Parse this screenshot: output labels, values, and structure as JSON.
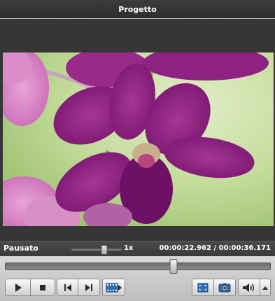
{
  "window": {
    "title": "Progetto"
  },
  "player": {
    "status": "Pausato",
    "speed_label": "1x",
    "speed_level": 0.65,
    "time_display": "00:00:22.962 / 00:00:36.171",
    "seek_progress": 0.635
  },
  "controls": {
    "buttons": [
      {
        "name": "play-button",
        "icon": "play-icon"
      },
      {
        "name": "stop-button",
        "icon": "stop-icon"
      },
      {
        "name": "previous-button",
        "icon": "skip-back-icon"
      },
      {
        "name": "next-button",
        "icon": "skip-forward-icon"
      },
      {
        "name": "clip-button",
        "icon": "film-icon"
      },
      {
        "name": "fullscreen-button",
        "icon": "fullscreen-icon"
      },
      {
        "name": "snapshot-button",
        "icon": "camera-icon"
      },
      {
        "name": "volume-button",
        "icon": "speaker-icon"
      },
      {
        "name": "volume-menu-button",
        "icon": "chevron-up-icon"
      }
    ]
  },
  "colors": {
    "accent_blue": "#2f6fb5",
    "flower_purple": "#8c1f7d",
    "background_green": "#b7d489"
  }
}
